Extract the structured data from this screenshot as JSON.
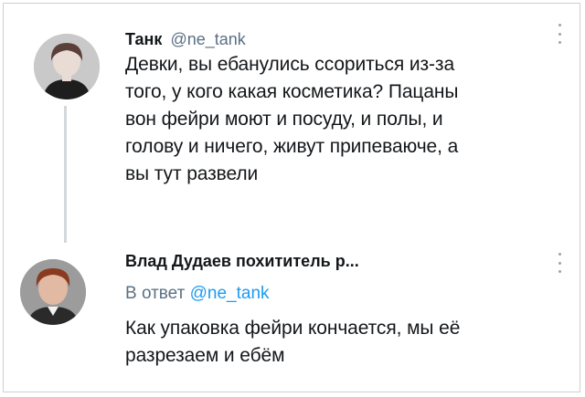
{
  "tweets": [
    {
      "author_name": "Танк",
      "author_handle": "@ne_tank",
      "avatar_icon": "user-avatar-woman",
      "text_lines": [
        "Девки, вы ебанулись ссориться из-за",
        "того, у кого какая косметика? Пацаны",
        "вон фейри моют и посуду, и полы, и",
        "голову и ничего, живут припеваюче, а",
        "вы тут развели"
      ]
    },
    {
      "author_name": "Влад Дудаев похититель р...",
      "avatar_icon": "user-avatar-boy",
      "reply_prefix": "В ответ",
      "reply_mention": "@ne_tank",
      "text_lines": [
        "Как упаковка фейри кончается, мы её",
        "разрезаем и ебём"
      ]
    }
  ],
  "colors": {
    "text": "#14171a",
    "secondary": "#5b7083",
    "mention": "#1d9bf0",
    "thread_line": "#d3d8dc"
  }
}
